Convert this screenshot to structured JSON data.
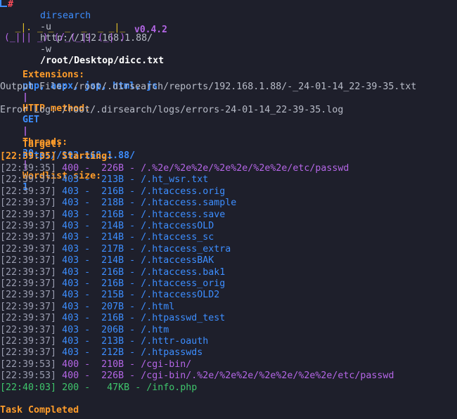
{
  "command": {
    "name": "dirsearch",
    "flag_u": "-u",
    "url": "http://192.168.1.88/",
    "flag_w": "-w",
    "wordlist": "/root/Desktop/dicc.txt"
  },
  "banner": {
    "logo_line1": "  _|. _ _  _  _  _ _|_",
    "logo_line2": "(_||| _) (/_(_|| (_| )",
    "version": "v0.4.2"
  },
  "config": {
    "ext_label": "Extensions:",
    "ext_value": "php, aspx, jsp, html, js",
    "sep1": "|",
    "method_label": "HTTP method:",
    "method_value": "GET",
    "sep2": "|",
    "threads_label": "Threads:",
    "threads_value": "30",
    "sep3": "|",
    "wordlist_label": "Wordlist size:",
    "wordlist_value": "1"
  },
  "output_file": "Output File: /root/.dirsearch/reports/192.168.1.88/-_24-01-14_22-39-35.txt",
  "error_log": "Error Log: /root/.dirsearch/logs/errors-24-01-14_22-39-35.log",
  "target": {
    "label": "Target:",
    "url": "http://192.168.1.88/"
  },
  "starting": "[22:39:35] Starting:",
  "results": [
    {
      "ts": "[22:39:35]",
      "code": "400",
      "size": " 226B",
      "path": "/.%2e/%2e%2e/%2e%2e/%2e%2e/etc/passwd"
    },
    {
      "ts": "[22:39:37]",
      "code": "403",
      "size": " 213B",
      "path": "/.ht_wsr.txt"
    },
    {
      "ts": "[22:39:37]",
      "code": "403",
      "size": " 216B",
      "path": "/.htaccess.orig"
    },
    {
      "ts": "[22:39:37]",
      "code": "403",
      "size": " 218B",
      "path": "/.htaccess.sample"
    },
    {
      "ts": "[22:39:37]",
      "code": "403",
      "size": " 216B",
      "path": "/.htaccess.save"
    },
    {
      "ts": "[22:39:37]",
      "code": "403",
      "size": " 214B",
      "path": "/.htaccessOLD"
    },
    {
      "ts": "[22:39:37]",
      "code": "403",
      "size": " 214B",
      "path": "/.htaccess_sc"
    },
    {
      "ts": "[22:39:37]",
      "code": "403",
      "size": " 217B",
      "path": "/.htaccess_extra"
    },
    {
      "ts": "[22:39:37]",
      "code": "403",
      "size": " 214B",
      "path": "/.htaccessBAK"
    },
    {
      "ts": "[22:39:37]",
      "code": "403",
      "size": " 216B",
      "path": "/.htaccess.bak1"
    },
    {
      "ts": "[22:39:37]",
      "code": "403",
      "size": " 216B",
      "path": "/.htaccess_orig"
    },
    {
      "ts": "[22:39:37]",
      "code": "403",
      "size": " 215B",
      "path": "/.htaccessOLD2"
    },
    {
      "ts": "[22:39:37]",
      "code": "403",
      "size": " 207B",
      "path": "/.html"
    },
    {
      "ts": "[22:39:37]",
      "code": "403",
      "size": " 216B",
      "path": "/.htpasswd_test"
    },
    {
      "ts": "[22:39:37]",
      "code": "403",
      "size": " 206B",
      "path": "/.htm"
    },
    {
      "ts": "[22:39:37]",
      "code": "403",
      "size": " 213B",
      "path": "/.httr-oauth"
    },
    {
      "ts": "[22:39:37]",
      "code": "403",
      "size": " 212B",
      "path": "/.htpasswds"
    },
    {
      "ts": "[22:39:53]",
      "code": "400",
      "size": " 210B",
      "path": "/cgi-bin/"
    },
    {
      "ts": "[22:39:53]",
      "code": "400",
      "size": " 226B",
      "path": "/cgi-bin/.%2e/%2e%2e/%2e%2e/%2e%2e/etc/passwd"
    },
    {
      "ts": "[22:40:03]",
      "code": "200",
      "size": "  47KB",
      "path": "/info.php"
    }
  ],
  "completed": "Task Completed",
  "colors": {
    "background": "#1e1f2b",
    "blue": "#3d8eff",
    "orange": "#ff9c2a",
    "purple": "#b466e6",
    "green": "#3fc56c",
    "yellow": "#e6c229"
  }
}
